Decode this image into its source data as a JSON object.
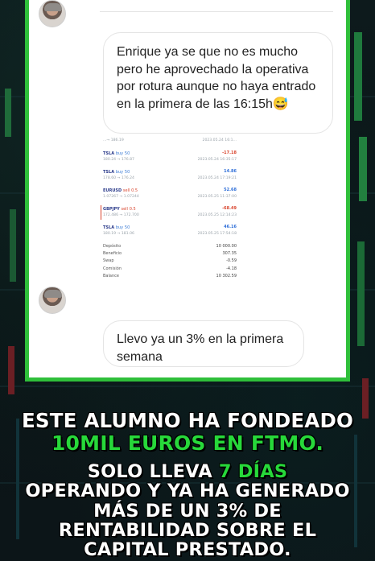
{
  "chat": {
    "message_1": "Enrique ya se que no es mucho pero he aprovechado la operativa por rotura aunque no haya entrado en la primera de las 16:15h😅",
    "message_2": "Llevo ya un 3% en la primera semana",
    "trades": [
      {
        "price": "...→ 186.19",
        "time": "2023.05.24 16:1...",
        "partial": true
      },
      {
        "symbol": "TSLA",
        "side": "buy",
        "size": "50",
        "price": "180.24 → 176.87",
        "time": "2023.05.24 16:35:17",
        "profit": "-17.18",
        "status": "neg"
      },
      {
        "symbol": "TSLA",
        "side": "buy",
        "size": "50",
        "price": "178.60 → 176.24",
        "time": "2023.05.24 17:19:21",
        "profit": "14.86",
        "status": "pos"
      },
      {
        "symbol": "EURUSD",
        "side": "sell",
        "size": "0.5",
        "price": "1.07267 → 1.07244",
        "time": "2023.05.25 11:37:00",
        "profit": "52.68",
        "status": "pos"
      },
      {
        "symbol": "GBPJPY",
        "side": "sell",
        "size": "0.5",
        "price": "172.486 → 172.700",
        "time": "2023.05.25 12:14:23",
        "profit": "-68.49",
        "status": "neg",
        "marked": true
      },
      {
        "symbol": "TSLA",
        "side": "buy",
        "size": "50",
        "price": "180.19 → 181.06",
        "time": "2023.05.25 17:54:18",
        "profit": "46.16",
        "status": "pos"
      }
    ],
    "summary": [
      {
        "label": "Depósito",
        "value": "10 000.00"
      },
      {
        "label": "Beneficio",
        "value": "307.35"
      },
      {
        "label": "Swap",
        "value": "-0.59"
      },
      {
        "label": "Comisión",
        "value": "-4.18"
      },
      {
        "label": "Balance",
        "value": "10 302.59"
      }
    ]
  },
  "caption": {
    "line1": "ESTE ALUMNO HA FONDEADO",
    "line2": "10MIL EUROS EN FTMO.",
    "line3_a": "SOLO LLEVA ",
    "line3_b": "7 DÍAS",
    "line4": "OPERANDO Y YA HA GENERADO",
    "line5": "MÁS DE UN 3% DE",
    "line6": "RENTABILIDAD SOBRE EL",
    "line7": "CAPITAL PRESTADO."
  },
  "colors": {
    "accent_green": "#27d83a",
    "frame_green": "#2fbf3a",
    "buy_blue": "#3a7bd5",
    "sell_red": "#d9452e"
  }
}
